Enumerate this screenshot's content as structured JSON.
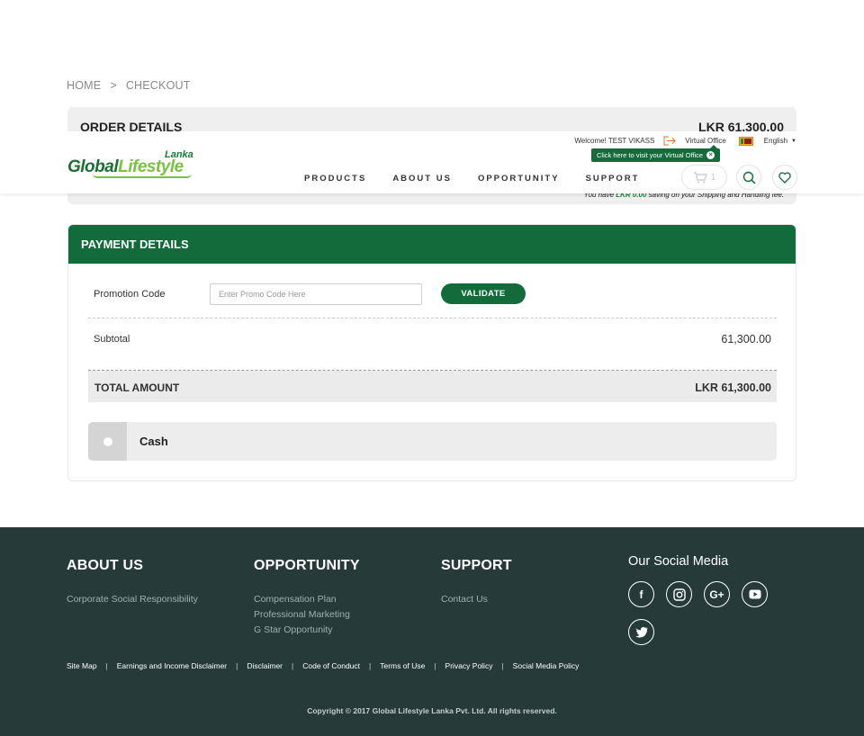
{
  "breadcrumb": {
    "home": "HOME",
    "separator": ">",
    "current": "CHECKOUT"
  },
  "order": {
    "title": "ORDER DETAILS",
    "amount": "LKR 61,300.00",
    "saving_prefix": "You have",
    "saving_amount": "LKR 0.00",
    "saving_suffix": "saving on your Shipping and Handling fee."
  },
  "header": {
    "logo_lanka": "Lanka",
    "logo_global": "Global",
    "logo_lifestyle": "Lifestyle",
    "welcome": "Welcome! TEST VIKASS",
    "virtual_office": "Virtual Office",
    "language": "English",
    "tooltip": "Click here to visit your Virtual Office",
    "nav": [
      "PRODUCTS",
      "ABOUT US",
      "OPPORTUNITY",
      "SUPPORT"
    ],
    "cart_count": "1",
    "accent_color": "#116b3b"
  },
  "payment": {
    "title": "PAYMENT DETAILS",
    "promo_label": "Promotion Code",
    "promo_placeholder": "Enter Promo Code Here",
    "promo_value": "",
    "validate_label": "VALIDATE",
    "subtotal_label": "Subtotal",
    "subtotal_value": "61,300.00",
    "total_label": "TOTAL AMOUNT",
    "total_value": "LKR 61,300.00",
    "method_label": "Cash"
  },
  "footer": {
    "about": {
      "title": "ABOUT US",
      "links": [
        "Corporate Social Responsibility"
      ]
    },
    "opportunity": {
      "title": "OPPORTUNITY",
      "links": [
        "Compensation Plan",
        "Professional Marketing",
        "G Star Opportunity"
      ]
    },
    "support": {
      "title": "SUPPORT",
      "links": [
        "Contact Us"
      ]
    },
    "social": {
      "title": "Our Social Media",
      "icons": [
        "facebook-icon",
        "instagram-icon",
        "google-plus-icon",
        "youtube-icon",
        "twitter-icon"
      ]
    },
    "legal_links": [
      "Site Map",
      "Earnings and Income Disclaimer",
      "Disclaimer",
      "Code of Conduct",
      "Terms of Use",
      "Privacy Policy",
      "Social Media Policy"
    ],
    "copyright": "Copyright © 2017 Global Lifestyle Lanka Pvt. Ltd. All rights reserved.",
    "bg_color": "#263a3a"
  }
}
